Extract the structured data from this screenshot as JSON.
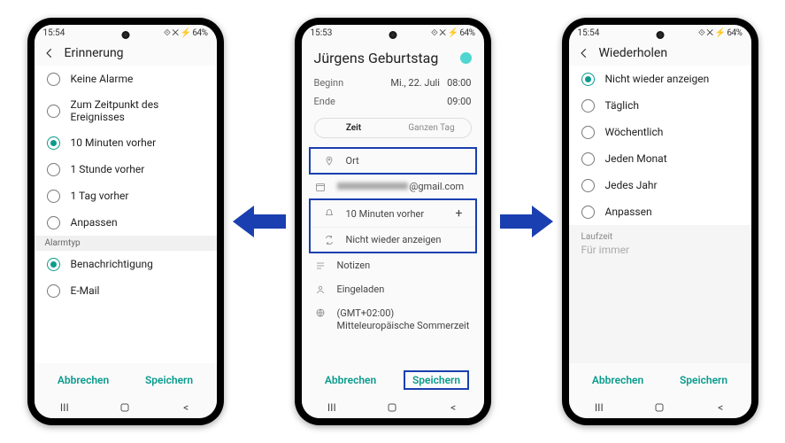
{
  "statusbar": {
    "time_left": "15:54",
    "time_center": "15:53",
    "icons": "⟐ ✕ ⚡ 64%"
  },
  "phone_left": {
    "title": "Erinnerung",
    "options": [
      {
        "label": "Keine Alarme",
        "selected": false
      },
      {
        "label": "Zum Zeitpunkt des Ereignisses",
        "selected": false
      },
      {
        "label": "10 Minuten vorher",
        "selected": true
      },
      {
        "label": "1 Stunde vorher",
        "selected": false
      },
      {
        "label": "1 Tag vorher",
        "selected": false
      },
      {
        "label": "Anpassen",
        "selected": false
      }
    ],
    "section_header": "Alarmtyp",
    "alarm_type": [
      {
        "label": "Benachrichtigung",
        "selected": true
      },
      {
        "label": "E-Mail",
        "selected": false
      }
    ],
    "cancel": "Abbrechen",
    "save": "Speichern"
  },
  "phone_center": {
    "event_title": "Jürgens Geburtstag",
    "start_label": "Beginn",
    "start_date": "Mi., 22. Juli",
    "start_time": "08:00",
    "end_label": "Ende",
    "end_time": "09:00",
    "seg_time": "Zeit",
    "seg_allday": "Ganzen Tag",
    "location_label": "Ort",
    "account_suffix": "@gmail.com",
    "reminder_label": "10 Minuten vorher",
    "repeat_label": "Nicht wieder anzeigen",
    "notes_label": "Notizen",
    "invited_label": "Eingeladen",
    "timezone_label": "(GMT+02:00) Mitteleuropäische Sommerzeit",
    "cancel": "Abbrechen",
    "save": "Speichern"
  },
  "phone_right": {
    "title": "Wiederholen",
    "options": [
      {
        "label": "Nicht wieder anzeigen",
        "selected": true
      },
      {
        "label": "Täglich",
        "selected": false
      },
      {
        "label": "Wöchentlich",
        "selected": false
      },
      {
        "label": "Jeden Monat",
        "selected": false
      },
      {
        "label": "Jedes Jahr",
        "selected": false
      },
      {
        "label": "Anpassen",
        "selected": false
      }
    ],
    "duration_label": "Laufzeit",
    "duration_value": "Für immer",
    "cancel": "Abbrechen",
    "save": "Speichern"
  }
}
